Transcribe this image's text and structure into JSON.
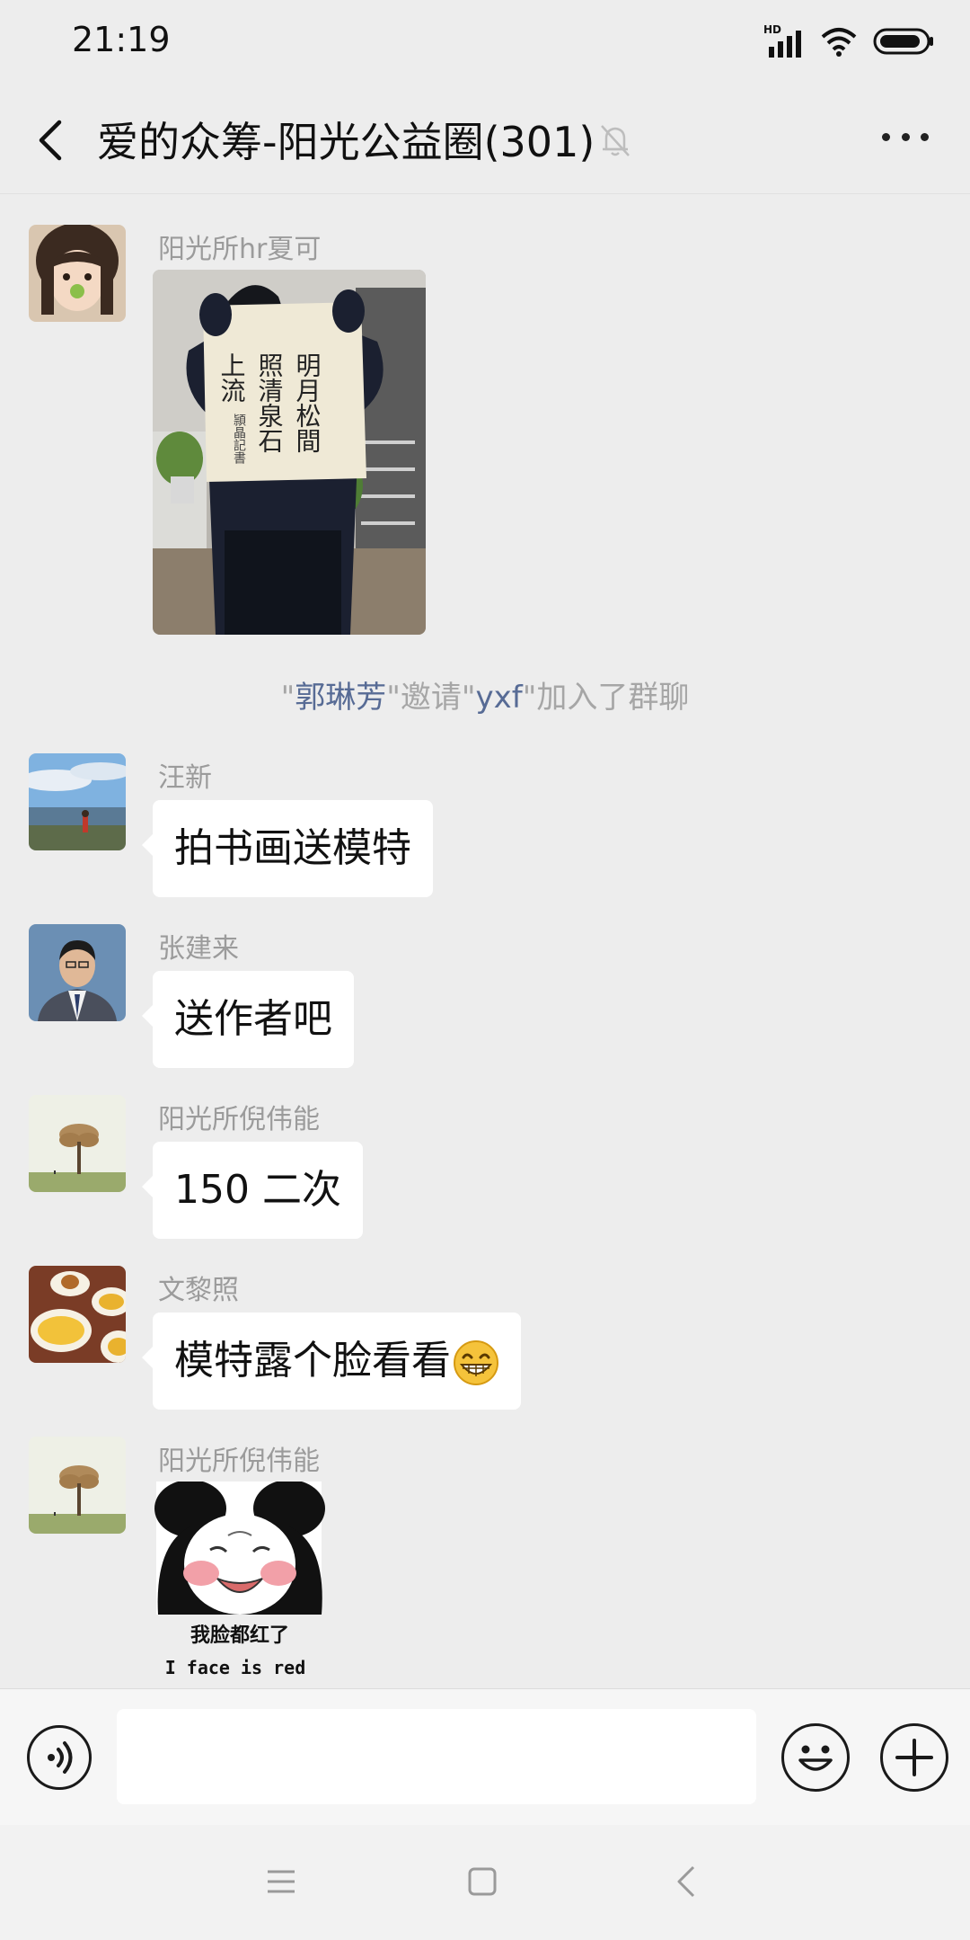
{
  "status_bar": {
    "time": "21:19",
    "hd_label": "HD"
  },
  "header": {
    "title": "爱的众筹-阳光公益圈(301)"
  },
  "messages": [
    {
      "sender": "阳光所hr夏可",
      "type": "image",
      "image_desc": "calligraphy-photo"
    },
    {
      "sender": "汪新",
      "text": "拍书画送模特"
    },
    {
      "sender": "张建来",
      "text": "送作者吧"
    },
    {
      "sender": "阳光所倪伟能",
      "text": "150 二次"
    },
    {
      "sender": "文黎照",
      "text": "模特露个脸看看"
    },
    {
      "sender": "阳光所倪伟能",
      "type": "sticker",
      "caption_cn": "我脸都红了",
      "caption_en": "I face is red"
    }
  ],
  "system_notice": {
    "q1": "\"",
    "inviter": "郭琳芳",
    "q2": "\"邀请\"",
    "invitee": "yxf",
    "q3": "\"加入了群聊"
  },
  "calligraphy": {
    "col1": "明月松間",
    "col2": "照清泉石",
    "col3": "上流",
    "sig": "頴晶記書"
  },
  "input": {
    "placeholder": ""
  },
  "colors": {
    "background": "#ededed",
    "bubble": "#ffffff",
    "sender_name": "#9b9b9b",
    "link_name": "#576b95",
    "system_text": "#a6a6a6"
  }
}
